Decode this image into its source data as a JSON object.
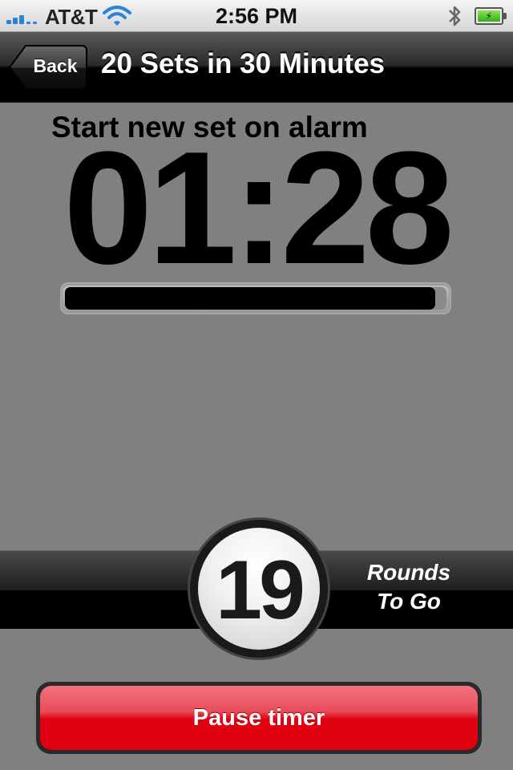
{
  "status_bar": {
    "carrier": "AT&T",
    "time": "2:56 PM",
    "signal_icon": "signal-bars-icon",
    "wifi_icon": "wifi-icon",
    "bluetooth_icon": "bluetooth-icon",
    "battery_icon": "battery-charging-icon"
  },
  "nav": {
    "back_label": "Back",
    "title": "20 Sets in 30 Minutes"
  },
  "main": {
    "instruction": "Start new set on alarm",
    "timer": "01:28",
    "progress_fraction": 0.97
  },
  "rounds": {
    "count": "19",
    "label_line1": "Rounds",
    "label_line2": "To Go"
  },
  "actions": {
    "pause_label": "Pause timer"
  },
  "colors": {
    "accent_red": "#e00012",
    "background": "#808080",
    "signal_blue": "#2c83d8",
    "battery_green": "#2fb114"
  }
}
